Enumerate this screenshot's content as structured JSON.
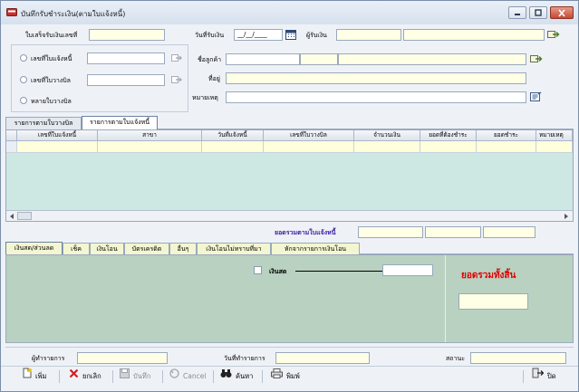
{
  "window": {
    "title": "บันทึกรับชำระเงิน(ตามใบแจ้งหนี้)"
  },
  "header": {
    "receipt_no_label": "ใบเสร็จรับเงินเลขที่",
    "receipt_no_value": "",
    "receive_date_label": "วันที่รับเงิน",
    "receive_date_value": "__/__/____",
    "receiver_label": "ผู้รับเงิน",
    "receiver_value": ""
  },
  "selection": {
    "option_invoice_label": "เลขที่ใบแจ้งหนี้",
    "option_bill_label": "เลขที่ใบวางบิล",
    "option_multi_bill_label": "หลายใบวางบิล",
    "customer_label": "ชื่อลูกค้า",
    "address_label": "ที่อยู่",
    "note_label": "หมายเหตุ"
  },
  "upper_tabs": [
    {
      "label": "รายการตามใบวางบิล"
    },
    {
      "label": "รายการตามใบแจ้งหนี้"
    }
  ],
  "grid": {
    "columns": [
      "เลขที่ใบแจ้งหนี้",
      "สาขา",
      "วันที่แจ้งหนี้",
      "เลขที่ใบวางบิล",
      "จำนวนเงิน",
      "ยอดที่ต้องชำระ",
      "ยอดชำระ",
      "หมายเหตุ"
    ]
  },
  "totals": {
    "invoice_total_label": "ยอดรวมตามใบแจ้งหนี้"
  },
  "payment_tabs": [
    {
      "label": "เงินสด/ส่วนลด"
    },
    {
      "label": "เช็ค"
    },
    {
      "label": "เงินโอน"
    },
    {
      "label": "บัตรเครดิต"
    },
    {
      "label": "อื่นๆ"
    },
    {
      "label": "เงินโอนไม่ทราบที่มา"
    },
    {
      "label": "หักจากรายการเงินโอน"
    }
  ],
  "payment": {
    "cash_label": "เงินสด",
    "grand_total_label": "ยอดรวมทั้งสิ้น"
  },
  "footer": {
    "maker_label": "ผู้ทำรายการ",
    "made_date_label": "วันที่ทำรายการ",
    "status_label": "สถานะ"
  },
  "toolbar": {
    "add_label": "เพิ่ม",
    "cancel_doc_label": "ยกเลิก",
    "save_label": "บันทึก",
    "cancel_label": "Cancel",
    "search_label": "ค้นหา",
    "print_label": "พิมพ์",
    "close_label": "ปิด"
  },
  "colors": {
    "yellow_field": "#ffffe6",
    "grid_bg": "#cde8e2",
    "payment_bg": "#b9d1c1",
    "active_tab": "#f3f6d0",
    "accent_red": "#e00000",
    "total_label": "#3a1fa3"
  }
}
